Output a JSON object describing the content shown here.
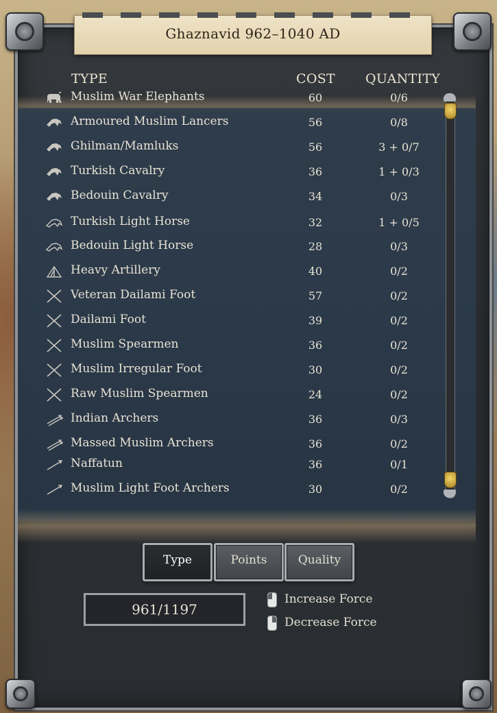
{
  "title": "Ghaznavid 962–1040 AD",
  "headers": {
    "type": "TYPE",
    "cost": "COST",
    "quantity": "QUANTITY"
  },
  "units": [
    {
      "name": "Muslim War Elephants",
      "cost": "60",
      "quantity": "0/6",
      "icon": "elephant-icon"
    },
    {
      "name": "Armoured Muslim Lancers",
      "cost": "56",
      "quantity": "0/8",
      "icon": "heavy-cavalry-icon"
    },
    {
      "name": "Ghilman/Mamluks",
      "cost": "56",
      "quantity": "3 + 0/7",
      "icon": "heavy-cavalry-icon"
    },
    {
      "name": "Turkish Cavalry",
      "cost": "36",
      "quantity": "1 + 0/3",
      "icon": "heavy-cavalry-icon"
    },
    {
      "name": "Bedouin Cavalry",
      "cost": "34",
      "quantity": "0/3",
      "icon": "heavy-cavalry-icon"
    },
    {
      "name": "Turkish Light Horse",
      "cost": "32",
      "quantity": "1 + 0/5",
      "icon": "light-horse-icon"
    },
    {
      "name": "Bedouin Light Horse",
      "cost": "28",
      "quantity": "0/3",
      "icon": "light-horse-icon"
    },
    {
      "name": "Heavy Artillery",
      "cost": "40",
      "quantity": "0/2",
      "icon": "artillery-icon"
    },
    {
      "name": "Veteran Dailami Foot",
      "cost": "57",
      "quantity": "0/2",
      "icon": "crossed-spears-icon"
    },
    {
      "name": "Dailami Foot",
      "cost": "39",
      "quantity": "0/2",
      "icon": "crossed-spears-icon"
    },
    {
      "name": "Muslim Spearmen",
      "cost": "36",
      "quantity": "0/2",
      "icon": "crossed-spears-icon"
    },
    {
      "name": "Muslim Irregular Foot",
      "cost": "30",
      "quantity": "0/2",
      "icon": "crossed-spears-icon"
    },
    {
      "name": "Raw Muslim Spearmen",
      "cost": "24",
      "quantity": "0/2",
      "icon": "crossed-spears-icon"
    },
    {
      "name": "Indian Archers",
      "cost": "36",
      "quantity": "0/3",
      "icon": "arrows-icon"
    },
    {
      "name": "Massed Muslim Archers",
      "cost": "36",
      "quantity": "0/2",
      "icon": "arrows-icon"
    },
    {
      "name": "Naffatun",
      "cost": "36",
      "quantity": "0/1",
      "icon": "arrow-icon"
    },
    {
      "name": "Muslim Light Foot Archers",
      "cost": "30",
      "quantity": "0/2",
      "icon": "arrow-icon"
    }
  ],
  "sort_buttons": {
    "type": "Type",
    "points": "Points",
    "quality": "Quality",
    "active": "Type"
  },
  "force_points": "961/1197",
  "hints": {
    "increase": "Increase Force",
    "decrease": "Decrease Force"
  }
}
